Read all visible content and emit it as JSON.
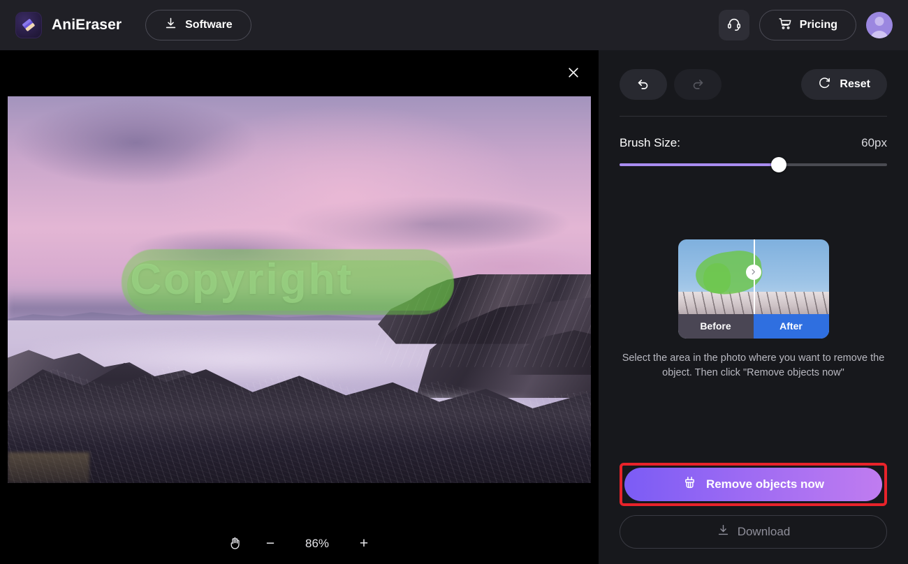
{
  "header": {
    "logo_icon": "eraser-logo-icon",
    "brand_name": "AniEraser",
    "software_label": "Software",
    "software_icon": "download-icon",
    "support_icon": "headset-icon",
    "pricing_label": "Pricing",
    "pricing_icon": "cart-icon",
    "avatar_icon": "user-avatar-icon"
  },
  "canvas": {
    "close_icon": "close-icon",
    "watermark_text": "Copyright",
    "mask_color": "#6fd04a",
    "zoom": {
      "hand_icon": "hand-tool-icon",
      "minus_label": "−",
      "percent": "86%",
      "plus_label": "+"
    }
  },
  "panel": {
    "undo_icon": "undo-icon",
    "redo_icon": "redo-icon",
    "reset_label": "Reset",
    "reset_icon": "reset-icon",
    "brush": {
      "label": "Brush Size:",
      "value": "60px",
      "fill_color": "#a98cf0"
    },
    "preview": {
      "before_label": "Before",
      "after_label": "After",
      "handle_icon": "chevron-right-icon"
    },
    "hint_line1": "Select the area in the photo where you want to remove the",
    "hint_line2": "object. Then click \"Remove objects now\"",
    "remove_label": "Remove objects now",
    "remove_icon": "brush-clean-icon",
    "download_label": "Download",
    "download_icon": "download-icon",
    "highlight_color": "#e8232a"
  }
}
